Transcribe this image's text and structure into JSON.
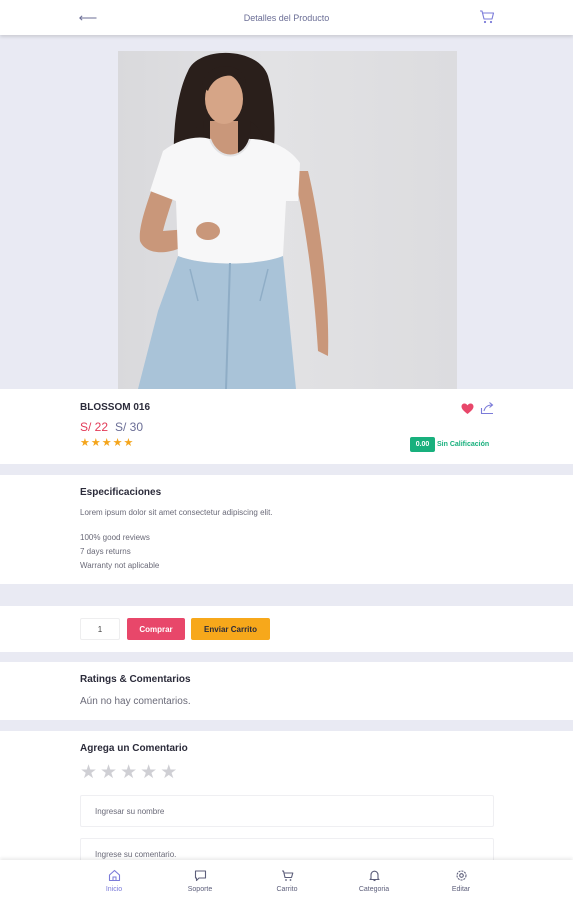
{
  "header": {
    "title": "Detalles del Producto",
    "back_icon": "arrow-left-icon",
    "cart_icon": "cart-icon"
  },
  "product": {
    "name": "BLOSSOM 016",
    "price_current": "S/ 22",
    "price_original": "S/ 30",
    "star_rating": 5,
    "rating_value": "0.00",
    "rating_label": "Sin Calificación"
  },
  "specs": {
    "title": "Especificaciones",
    "description": "Lorem ipsum dolor sit amet consectetur adipiscing elit.",
    "items": [
      "100% good reviews",
      "7 days returns",
      "Warranty not aplicable"
    ]
  },
  "purchase": {
    "quantity": "1",
    "buy_label": "Comprar",
    "cart_label": "Enviar Carrito"
  },
  "ratings": {
    "title": "Ratings & Comentarios",
    "empty_text": "Aún no hay comentarios."
  },
  "comment_form": {
    "title": "Agrega un Comentario",
    "name_placeholder": "Ingresar su nombre",
    "comment_placeholder": "Ingrese su comentario."
  },
  "nav": [
    {
      "label": "Inicio",
      "icon": "home-icon",
      "active": true
    },
    {
      "label": "Soporte",
      "icon": "chat-icon",
      "active": false
    },
    {
      "label": "Carrito",
      "icon": "cart-icon",
      "active": false
    },
    {
      "label": "Categoria",
      "icon": "bell-icon",
      "active": false
    },
    {
      "label": "Editar",
      "icon": "gear-icon",
      "active": false
    }
  ],
  "colors": {
    "accent": "#7b7bd9",
    "price": "#e23a57",
    "buy": "#e8476a",
    "cart": "#f7a81b",
    "rating": "#18b07d",
    "star": "#f4a51c"
  }
}
